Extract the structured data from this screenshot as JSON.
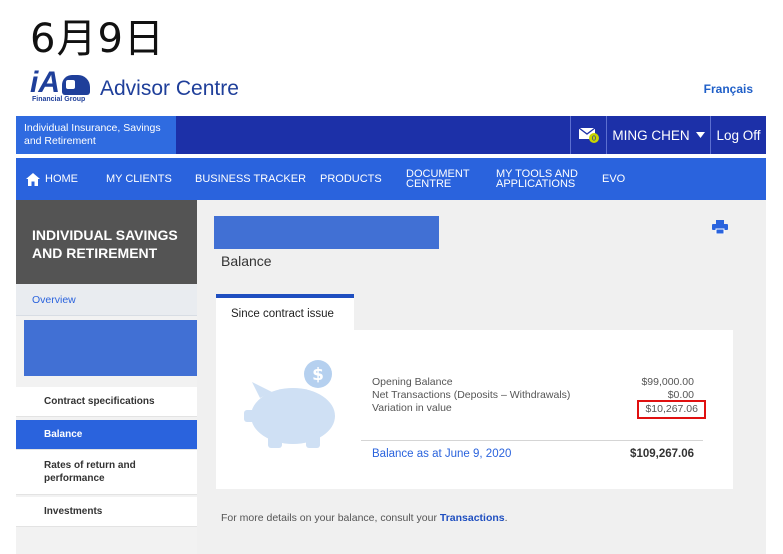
{
  "header": {
    "date": "6月9日",
    "brand_logo_text": "iA",
    "brand_logo_sub": "Financial Group",
    "app_title": "Advisor Centre",
    "language_link": "Français"
  },
  "top_bar": {
    "section_label": "Individual Insurance, Savings and Retirement",
    "mail_count": "0",
    "user_name": "MING CHEN",
    "logoff_label": "Log Off"
  },
  "nav": {
    "items": [
      "HOME",
      "MY CLIENTS",
      "BUSINESS TRACKER",
      "PRODUCTS",
      "DOCUMENT CENTRE",
      "MY TOOLS AND APPLICATIONS",
      "EVO"
    ]
  },
  "sidebar": {
    "heading": "INDIVIDUAL SAVINGS AND RETIREMENT",
    "overview": "Overview",
    "items": [
      "Contract specifications",
      "Balance",
      "Rates of return and performance",
      "Investments"
    ],
    "active_index": 1
  },
  "main": {
    "page_title": "Balance",
    "tab_label": "Since contract issue",
    "rows": [
      {
        "label": "Opening Balance",
        "value": "$99,000.00"
      },
      {
        "label": "Net Transactions (Deposits – Withdrawals)",
        "value": "$0.00"
      },
      {
        "label": "Variation in value",
        "value": "$10,267.06"
      }
    ],
    "total_label": "Balance as at June 9, 2020",
    "total_value": "$109,267.06",
    "footnote_prefix": "For more details on your balance, consult your ",
    "footnote_link": "Transactions",
    "footnote_suffix": "."
  },
  "colors": {
    "brand_blue": "#1f3f9a",
    "top_bar": "#1c30a8",
    "nav_bar": "#2a63dd",
    "highlight_border": "#e01010"
  }
}
